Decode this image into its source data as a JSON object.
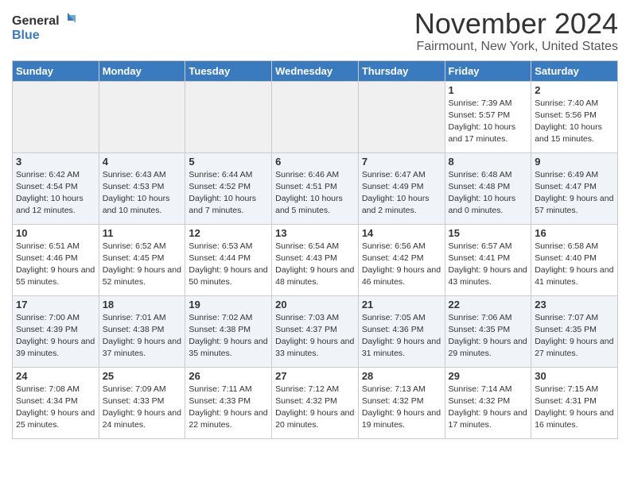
{
  "logo": {
    "general": "General",
    "blue": "Blue"
  },
  "title": "November 2024",
  "location": "Fairmount, New York, United States",
  "weekdays": [
    "Sunday",
    "Monday",
    "Tuesday",
    "Wednesday",
    "Thursday",
    "Friday",
    "Saturday"
  ],
  "weeks": [
    [
      {
        "day": "",
        "empty": true
      },
      {
        "day": "",
        "empty": true
      },
      {
        "day": "",
        "empty": true
      },
      {
        "day": "",
        "empty": true
      },
      {
        "day": "",
        "empty": true
      },
      {
        "day": "1",
        "sunrise": "Sunrise: 7:39 AM",
        "sunset": "Sunset: 5:57 PM",
        "daylight": "Daylight: 10 hours and 17 minutes."
      },
      {
        "day": "2",
        "sunrise": "Sunrise: 7:40 AM",
        "sunset": "Sunset: 5:56 PM",
        "daylight": "Daylight: 10 hours and 15 minutes."
      }
    ],
    [
      {
        "day": "3",
        "sunrise": "Sunrise: 6:42 AM",
        "sunset": "Sunset: 4:54 PM",
        "daylight": "Daylight: 10 hours and 12 minutes."
      },
      {
        "day": "4",
        "sunrise": "Sunrise: 6:43 AM",
        "sunset": "Sunset: 4:53 PM",
        "daylight": "Daylight: 10 hours and 10 minutes."
      },
      {
        "day": "5",
        "sunrise": "Sunrise: 6:44 AM",
        "sunset": "Sunset: 4:52 PM",
        "daylight": "Daylight: 10 hours and 7 minutes."
      },
      {
        "day": "6",
        "sunrise": "Sunrise: 6:46 AM",
        "sunset": "Sunset: 4:51 PM",
        "daylight": "Daylight: 10 hours and 5 minutes."
      },
      {
        "day": "7",
        "sunrise": "Sunrise: 6:47 AM",
        "sunset": "Sunset: 4:49 PM",
        "daylight": "Daylight: 10 hours and 2 minutes."
      },
      {
        "day": "8",
        "sunrise": "Sunrise: 6:48 AM",
        "sunset": "Sunset: 4:48 PM",
        "daylight": "Daylight: 10 hours and 0 minutes."
      },
      {
        "day": "9",
        "sunrise": "Sunrise: 6:49 AM",
        "sunset": "Sunset: 4:47 PM",
        "daylight": "Daylight: 9 hours and 57 minutes."
      }
    ],
    [
      {
        "day": "10",
        "sunrise": "Sunrise: 6:51 AM",
        "sunset": "Sunset: 4:46 PM",
        "daylight": "Daylight: 9 hours and 55 minutes."
      },
      {
        "day": "11",
        "sunrise": "Sunrise: 6:52 AM",
        "sunset": "Sunset: 4:45 PM",
        "daylight": "Daylight: 9 hours and 52 minutes."
      },
      {
        "day": "12",
        "sunrise": "Sunrise: 6:53 AM",
        "sunset": "Sunset: 4:44 PM",
        "daylight": "Daylight: 9 hours and 50 minutes."
      },
      {
        "day": "13",
        "sunrise": "Sunrise: 6:54 AM",
        "sunset": "Sunset: 4:43 PM",
        "daylight": "Daylight: 9 hours and 48 minutes."
      },
      {
        "day": "14",
        "sunrise": "Sunrise: 6:56 AM",
        "sunset": "Sunset: 4:42 PM",
        "daylight": "Daylight: 9 hours and 46 minutes."
      },
      {
        "day": "15",
        "sunrise": "Sunrise: 6:57 AM",
        "sunset": "Sunset: 4:41 PM",
        "daylight": "Daylight: 9 hours and 43 minutes."
      },
      {
        "day": "16",
        "sunrise": "Sunrise: 6:58 AM",
        "sunset": "Sunset: 4:40 PM",
        "daylight": "Daylight: 9 hours and 41 minutes."
      }
    ],
    [
      {
        "day": "17",
        "sunrise": "Sunrise: 7:00 AM",
        "sunset": "Sunset: 4:39 PM",
        "daylight": "Daylight: 9 hours and 39 minutes."
      },
      {
        "day": "18",
        "sunrise": "Sunrise: 7:01 AM",
        "sunset": "Sunset: 4:38 PM",
        "daylight": "Daylight: 9 hours and 37 minutes."
      },
      {
        "day": "19",
        "sunrise": "Sunrise: 7:02 AM",
        "sunset": "Sunset: 4:38 PM",
        "daylight": "Daylight: 9 hours and 35 minutes."
      },
      {
        "day": "20",
        "sunrise": "Sunrise: 7:03 AM",
        "sunset": "Sunset: 4:37 PM",
        "daylight": "Daylight: 9 hours and 33 minutes."
      },
      {
        "day": "21",
        "sunrise": "Sunrise: 7:05 AM",
        "sunset": "Sunset: 4:36 PM",
        "daylight": "Daylight: 9 hours and 31 minutes."
      },
      {
        "day": "22",
        "sunrise": "Sunrise: 7:06 AM",
        "sunset": "Sunset: 4:35 PM",
        "daylight": "Daylight: 9 hours and 29 minutes."
      },
      {
        "day": "23",
        "sunrise": "Sunrise: 7:07 AM",
        "sunset": "Sunset: 4:35 PM",
        "daylight": "Daylight: 9 hours and 27 minutes."
      }
    ],
    [
      {
        "day": "24",
        "sunrise": "Sunrise: 7:08 AM",
        "sunset": "Sunset: 4:34 PM",
        "daylight": "Daylight: 9 hours and 25 minutes."
      },
      {
        "day": "25",
        "sunrise": "Sunrise: 7:09 AM",
        "sunset": "Sunset: 4:33 PM",
        "daylight": "Daylight: 9 hours and 24 minutes."
      },
      {
        "day": "26",
        "sunrise": "Sunrise: 7:11 AM",
        "sunset": "Sunset: 4:33 PM",
        "daylight": "Daylight: 9 hours and 22 minutes."
      },
      {
        "day": "27",
        "sunrise": "Sunrise: 7:12 AM",
        "sunset": "Sunset: 4:32 PM",
        "daylight": "Daylight: 9 hours and 20 minutes."
      },
      {
        "day": "28",
        "sunrise": "Sunrise: 7:13 AM",
        "sunset": "Sunset: 4:32 PM",
        "daylight": "Daylight: 9 hours and 19 minutes."
      },
      {
        "day": "29",
        "sunrise": "Sunrise: 7:14 AM",
        "sunset": "Sunset: 4:32 PM",
        "daylight": "Daylight: 9 hours and 17 minutes."
      },
      {
        "day": "30",
        "sunrise": "Sunrise: 7:15 AM",
        "sunset": "Sunset: 4:31 PM",
        "daylight": "Daylight: 9 hours and 16 minutes."
      }
    ]
  ]
}
